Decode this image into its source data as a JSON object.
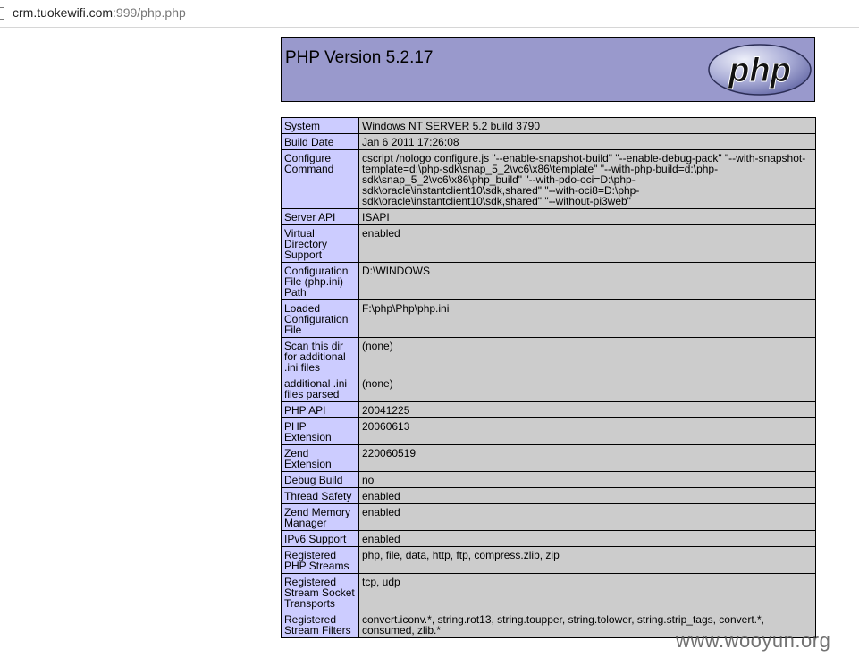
{
  "address_bar": {
    "host": "crm.tuokewifi.com",
    "rest": ":999/php.php"
  },
  "header": {
    "title": "PHP Version 5.2.17",
    "logo_text": "php"
  },
  "rows": [
    {
      "label": "System",
      "value": "Windows NT SERVER 5.2 build 3790"
    },
    {
      "label": "Build Date",
      "value": "Jan 6 2011 17:26:08"
    },
    {
      "label": "Configure Command",
      "value": "cscript /nologo configure.js \"--enable-snapshot-build\" \"--enable-debug-pack\" \"--with-snapshot-template=d:\\php-sdk\\snap_5_2\\vc6\\x86\\template\" \"--with-php-build=d:\\php-sdk\\snap_5_2\\vc6\\x86\\php_build\" \"--with-pdo-oci=D:\\php-sdk\\oracle\\instantclient10\\sdk,shared\" \"--with-oci8=D:\\php-sdk\\oracle\\instantclient10\\sdk,shared\" \"--without-pi3web\""
    },
    {
      "label": "Server API",
      "value": "ISAPI"
    },
    {
      "label": "Virtual Directory Support",
      "value": "enabled"
    },
    {
      "label": "Configuration File (php.ini) Path",
      "value": "D:\\WINDOWS"
    },
    {
      "label": "Loaded Configuration File",
      "value": "F:\\php\\Php\\php.ini"
    },
    {
      "label": "Scan this dir for additional .ini files",
      "value": "(none)"
    },
    {
      "label": "additional .ini files parsed",
      "value": "(none)"
    },
    {
      "label": "PHP API",
      "value": "20041225"
    },
    {
      "label": "PHP Extension",
      "value": "20060613"
    },
    {
      "label": "Zend Extension",
      "value": "220060519"
    },
    {
      "label": "Debug Build",
      "value": "no"
    },
    {
      "label": "Thread Safety",
      "value": "enabled"
    },
    {
      "label": "Zend Memory Manager",
      "value": "enabled"
    },
    {
      "label": "IPv6 Support",
      "value": "enabled"
    },
    {
      "label": "Registered PHP Streams",
      "value": "php, file, data, http, ftp, compress.zlib, zip"
    },
    {
      "label": "Registered Stream Socket Transports",
      "value": "tcp, udp"
    },
    {
      "label": "Registered Stream Filters",
      "value": "convert.iconv.*, string.rot13, string.toupper, string.tolower, string.strip_tags, convert.*, consumed, zlib.*"
    }
  ],
  "watermark": "www.wooyun.org",
  "colors": {
    "header_bg": "#9999cc",
    "label_cell_bg": "#ccccff",
    "value_cell_bg": "#cccccc"
  }
}
